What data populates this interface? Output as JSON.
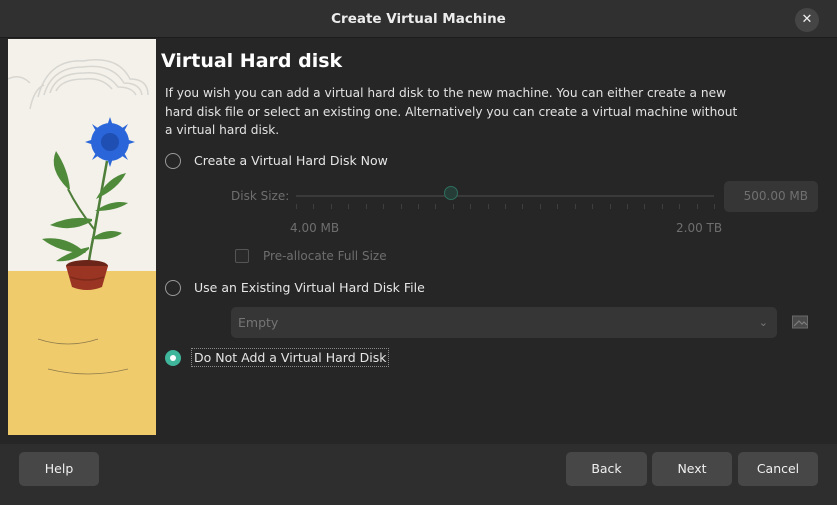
{
  "window": {
    "title": "Create Virtual Machine"
  },
  "page": {
    "heading": "Virtual Hard disk",
    "description": "If you wish you can add a virtual hard disk to the new machine. You can either create a new hard disk file or select an existing one. Alternatively you can create a virtual machine without a virtual hard disk."
  },
  "options": {
    "create_now": {
      "label": "Create a Virtual Hard Disk Now",
      "selected": false
    },
    "use_existing": {
      "label": "Use an Existing Virtual Hard Disk File",
      "selected": false
    },
    "do_not_add": {
      "label": "Do Not Add a Virtual Hard Disk",
      "selected": true
    }
  },
  "disk": {
    "size_label": "Disk Size:",
    "size_value": "500.00 MB",
    "min_label": "4.00 MB",
    "max_label": "2.00 TB",
    "preallocate_label": "Pre-allocate Full Size",
    "preallocate_checked": false,
    "slider_fraction": 0.37
  },
  "existing": {
    "selected_value": "Empty"
  },
  "footer": {
    "help": "Help",
    "back": "Back",
    "next": "Next",
    "cancel": "Cancel"
  },
  "colors": {
    "accent": "#3fb59b",
    "background": "#262626",
    "disabled_text": "#6e6e6e"
  },
  "icons": {
    "close": "close-icon",
    "dropdown": "chevron-down-icon",
    "folder": "folder-icon"
  }
}
